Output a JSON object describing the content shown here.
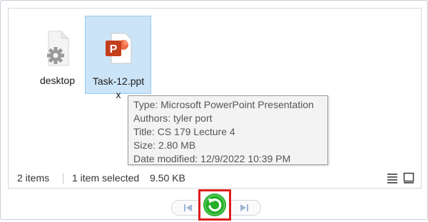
{
  "files": [
    {
      "name": "desktop",
      "icon": "settings-file-icon",
      "selected": false
    },
    {
      "name": "Task-12.pptx",
      "icon": "powerpoint-file-icon",
      "selected": true
    }
  ],
  "tooltip": {
    "type": "Type: Microsoft PowerPoint Presentation",
    "authors": "Authors: tyler port",
    "title": "Title: CS 179 Lecture 4",
    "size": "Size: 2.80 MB",
    "modified": "Date modified: 12/9/2022 10:39 PM"
  },
  "status": {
    "items": "2 items",
    "selected": "1 item selected",
    "selected_size": "9.50 KB"
  },
  "colors": {
    "selection_bg": "#cce4f7",
    "powerpoint": "#c43e1c",
    "highlight_box": "#e01a1a",
    "refresh_green": "#25b02a"
  }
}
